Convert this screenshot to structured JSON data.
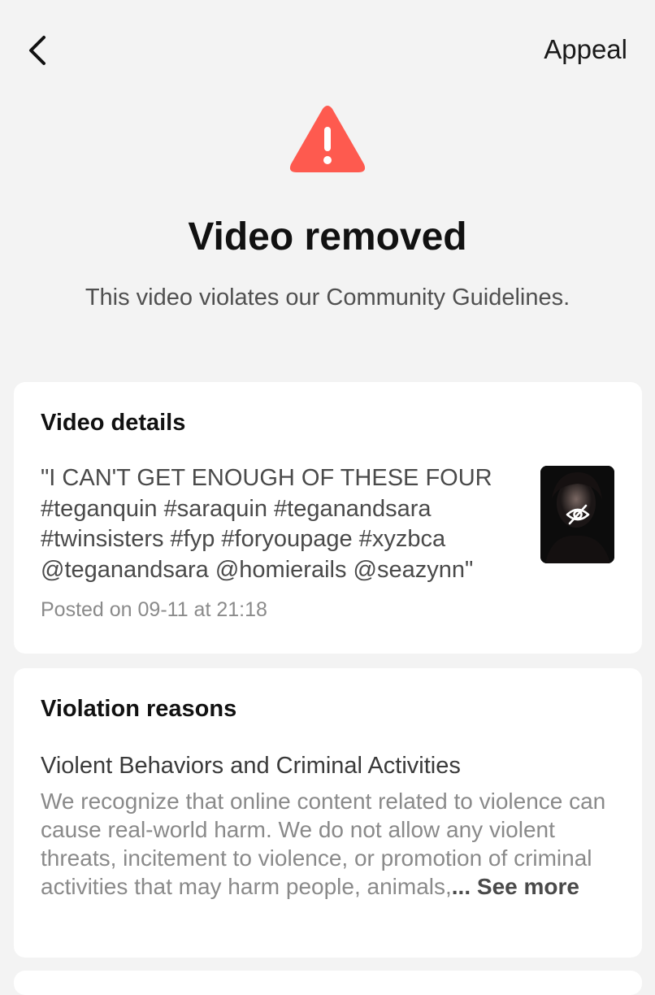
{
  "header": {
    "appeal_label": "Appeal"
  },
  "status": {
    "title": "Video removed",
    "subtitle": "This video violates our Community Guidelines.",
    "warning_color": "#fe5a4f"
  },
  "video_details": {
    "heading": "Video details",
    "caption": "\"I CAN'T GET ENOUGH OF THESE FOUR\n#teganquin #saraquin #teganandsara\n#twinsisters #fyp #foryoupage #xyzbca\n@teganandsara @homierails @seazynn\"",
    "posted": "Posted on 09-11 at 21:18",
    "thumbnail_icon": "eye-slash-icon"
  },
  "violation": {
    "heading": "Violation reasons",
    "reason_title": "Violent Behaviors and Criminal Activities",
    "reason_text": "We recognize that online content related to violence can cause real-world harm. We do not allow any violent threats, incitement to violence, or promotion of criminal activities that may harm people, animals,",
    "ellipsis": "...",
    "see_more": "See more"
  }
}
